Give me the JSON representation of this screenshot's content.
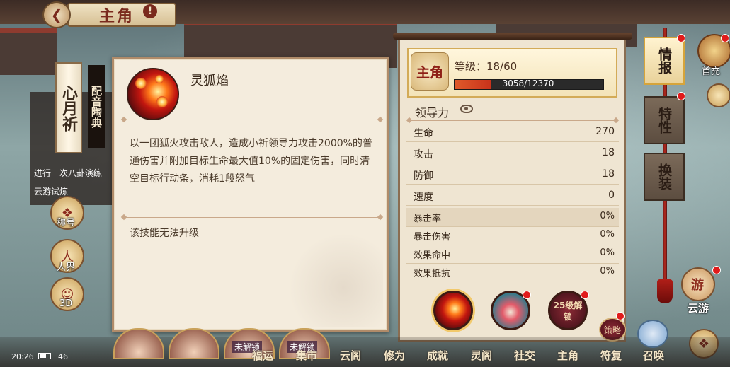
{
  "header": {
    "title": "主角",
    "back_icon": "back-arrow-icon",
    "help_icon": "exclamation-icon"
  },
  "left": {
    "banner": "心月祈",
    "voice_banner": "配音陶典",
    "missions": [
      "进行一次八卦演练",
      "云游试炼"
    ],
    "buttons": [
      {
        "label": "称号",
        "icon": "title-badge-icon"
      },
      {
        "label": "人界",
        "icon": "human-realm-icon",
        "glyph": "人"
      },
      {
        "label": "3D",
        "icon": "3d-model-icon"
      }
    ]
  },
  "skill_popup": {
    "name": "灵狐焰",
    "description": "以一团狐火攻击敌人，造成小祈领导力攻击2000%的普通伤害并附加目标生命最大值10%的固定伤害，同时清空目标行动条，消耗1段怒气",
    "upgrade_note": "该技能无法升级"
  },
  "stats_panel": {
    "hero_tag": "主角",
    "level_label": "等级：18/60",
    "exp_text": "3058/12370",
    "exp_fraction": 0.247,
    "section_title": "领导力",
    "stats": [
      {
        "name": "生命",
        "value": "270"
      },
      {
        "name": "攻击",
        "value": "18"
      },
      {
        "name": "防御",
        "value": "18"
      },
      {
        "name": "速度",
        "value": "0"
      },
      {
        "name": "暴击率",
        "value": "0%"
      },
      {
        "name": "暴击伤害",
        "value": "0%"
      },
      {
        "name": "效果命中",
        "value": "0%"
      },
      {
        "name": "效果抵抗",
        "value": "0%"
      }
    ],
    "locked_skill_text": "25级解锁",
    "strategy_label": "策略"
  },
  "right_tabs": [
    {
      "label": "情报",
      "active": true
    },
    {
      "label": "特性",
      "active": false
    },
    {
      "label": "换装",
      "active": false
    }
  ],
  "right_edge": {
    "first_charge": "首充",
    "cloud_travel": "云游",
    "cloud_travel_glyph": "游"
  },
  "bottom_nav": [
    "福运",
    "集市",
    "云阁",
    "修为",
    "成就",
    "灵阁",
    "社交",
    "主角",
    "符复",
    "召唤"
  ],
  "bottom_locked": [
    "未解锁",
    "未解锁"
  ],
  "status_bar": {
    "time": "20:26",
    "battery": "46"
  },
  "colors": {
    "accent": "#7a2a1d",
    "exp_fill": "#e05a2a",
    "notify": "#e01b1b"
  }
}
